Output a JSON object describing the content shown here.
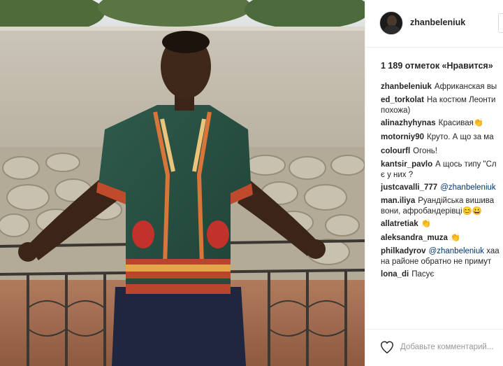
{
  "post": {
    "username": "zhanbeleniuk",
    "likes_text": "1 189 отметок «Нравится»",
    "comments": [
      {
        "user": "zhanbeleniuk",
        "text": "Африканская вы"
      },
      {
        "user": "ed_torkolat",
        "text": "На костюм Леонти",
        "text2": "похожа)"
      },
      {
        "user": "alinazhyhynas",
        "text": "Красивая👏"
      },
      {
        "user": "motorniy90",
        "text": "Круто. А що за ма"
      },
      {
        "user": "colourfl",
        "text": "Огонь!"
      },
      {
        "user": "kantsir_pavlo",
        "text": "А щось типу \"Сл",
        "text2": "є у них ?"
      },
      {
        "user": "justcavalli_777",
        "mention": "@zhanbeleniuk"
      },
      {
        "user": "man.iliya",
        "text": "Руандійська вишива",
        "text2": "вони, афробандерівці😊😀"
      },
      {
        "user": "allatretiak",
        "text": "👏"
      },
      {
        "user": "aleksandra_muza",
        "text": "👏"
      },
      {
        "user": "philkadyrov",
        "mention": "@zhanbeleniuk",
        "text": "хаа",
        "text2": "на районе обратно не примут"
      },
      {
        "user": "lona_di",
        "text": "Пасує"
      }
    ],
    "add_comment_placeholder": "Добавьте комментарий...",
    "icons": {
      "like": "heart-icon",
      "avatar": "avatar"
    },
    "colors": {
      "username": "#262626",
      "mention": "#003569",
      "border": "#efefef",
      "placeholder": "#999999"
    }
  }
}
